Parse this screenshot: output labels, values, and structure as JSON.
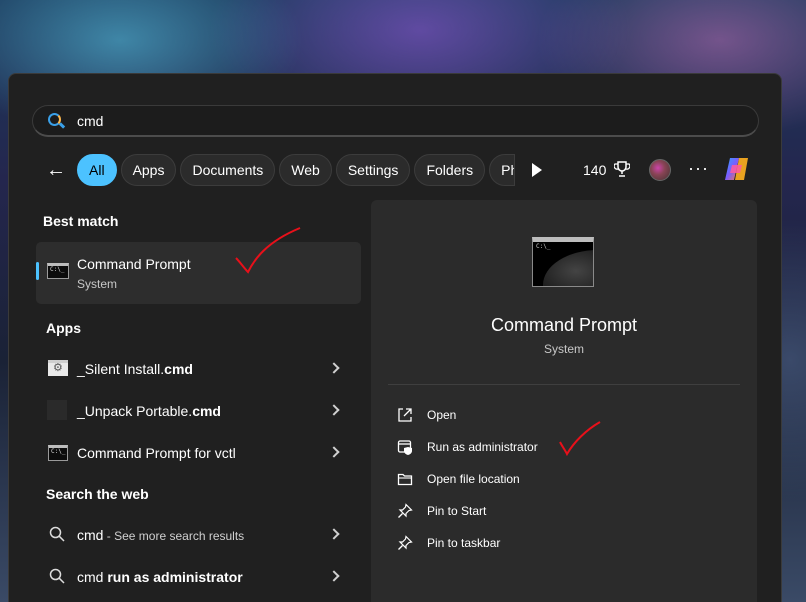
{
  "search": {
    "value": "cmd"
  },
  "filters": {
    "back_label": "←",
    "chips": [
      "All",
      "Apps",
      "Documents",
      "Web",
      "Settings",
      "Folders",
      "Ph"
    ],
    "count": "140",
    "more_label": "···"
  },
  "best_match": {
    "heading": "Best match",
    "title": "Command Prompt",
    "subtitle": "System"
  },
  "apps": {
    "heading": "Apps",
    "items": [
      {
        "prefix": "_Silent Install.",
        "bold": "cmd"
      },
      {
        "prefix": "_Unpack Portable.",
        "bold": "cmd"
      },
      {
        "prefix": "Command Prompt for vctl",
        "bold": ""
      }
    ]
  },
  "web": {
    "heading": "Search the web",
    "items": [
      {
        "bold": "cmd",
        "rest": " - See more search results"
      },
      {
        "bold": "cmd",
        "rest": " run as administrator"
      }
    ]
  },
  "detail": {
    "title": "Command Prompt",
    "subtitle": "System",
    "actions": [
      "Open",
      "Run as administrator",
      "Open file location",
      "Pin to Start",
      "Pin to taskbar"
    ]
  },
  "colors": {
    "accent": "#4cc2ff",
    "annotation": "#e8101a",
    "panel": "#202020",
    "detail_pane": "#2b2b2b"
  }
}
